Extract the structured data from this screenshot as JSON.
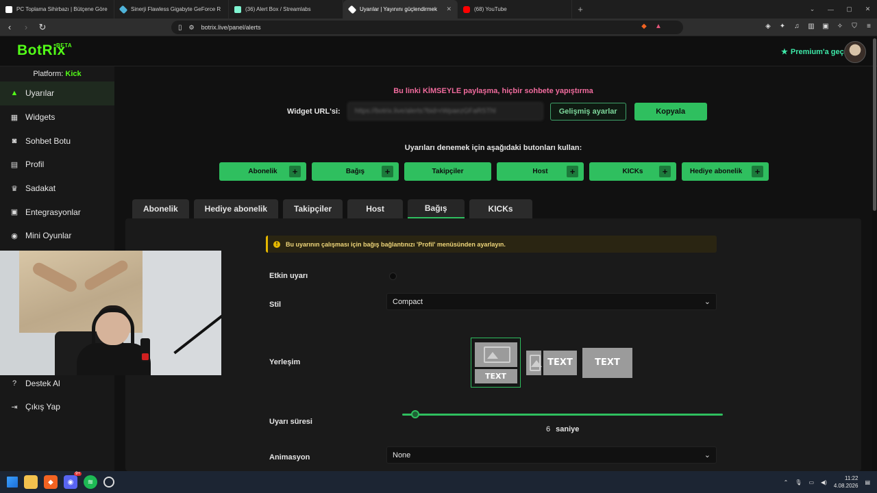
{
  "browser": {
    "tabs": [
      {
        "title": "PC Toplama Sihirbazı | Bütçene Göre",
        "favicon_color": "#ffffff",
        "active": false
      },
      {
        "title": "Sinerji Flawless Gigabyte GeForce R",
        "favicon_color": "#4fb3d9",
        "active": false
      },
      {
        "title": "(36) Alert Box / Streamlabs",
        "favicon_color": "#80f5d2",
        "active": false
      },
      {
        "title": "Uyarılar | Yayınını güçlendirmek",
        "favicon_color": "#ffffff",
        "active": true
      },
      {
        "title": "(68) YouTube",
        "favicon_color": "#ff0000",
        "active": false
      }
    ],
    "url": "botrix.live/panel/alerts"
  },
  "header": {
    "logo": "BotRix",
    "logo_badge": "BETA",
    "premium": "Premium'a geç"
  },
  "sidebar": {
    "platform_label": "Platform:",
    "platform_value": "Kick",
    "items": [
      {
        "label": "Uyarılar",
        "icon": "warning-icon",
        "active": true
      },
      {
        "label": "Widgets",
        "icon": "grid-icon",
        "active": false
      },
      {
        "label": "Sohbet Botu",
        "icon": "robot-icon",
        "active": false
      },
      {
        "label": "Profil",
        "icon": "id-card-icon",
        "active": false
      },
      {
        "label": "Sadakat",
        "icon": "trophy-icon",
        "active": false
      },
      {
        "label": "Entegrasyonlar",
        "icon": "integration-icon",
        "active": false
      },
      {
        "label": "Mini Oyunlar",
        "icon": "gamepad-icon",
        "active": false
      }
    ],
    "bottom_items": [
      {
        "label": "Destek Al",
        "icon": "help-icon"
      },
      {
        "label": "Çıkış Yap",
        "icon": "logout-icon"
      }
    ]
  },
  "main": {
    "share_warning": "Bu linki KİMSEYLE paylaşma, hiçbir sohbete yapıştırma",
    "widget_url_label": "Widget URL'si:",
    "widget_url_value": "https://botrix.live/alerts?bid=rWpaezGFaRSThl",
    "advanced_button": "Gelişmiş ayarlar",
    "copy_button": "Kopyala",
    "test_title": "Uyarıları denemek için aşağıdaki butonları kullan:",
    "test_buttons": [
      "Abonelik",
      "Bağış",
      "Takipçiler",
      "Host",
      "KICKs",
      "Hediye abonelik"
    ],
    "tabs": [
      "Abonelik",
      "Hediye abonelik",
      "Takipçiler",
      "Host",
      "Bağış",
      "KICKs"
    ],
    "active_tab": "Bağış",
    "alert_message": "Bu uyarının çalışması için bağış bağlantınızı 'Profil' menüsünden ayarlayın.",
    "fields": {
      "enabled_label": "Etkin uyarı",
      "style_label": "Stil",
      "style_value": "Compact",
      "layout_label": "Yerleşim",
      "layout_text": "TEXT",
      "duration_label": "Uyarı süresi",
      "duration_value": "6",
      "duration_unit": "saniye",
      "duration_fraction": 0.04,
      "animation_label": "Animasyon",
      "animation_value": "None"
    }
  },
  "taskbar": {
    "time": "11:22",
    "date": "4.08.2026",
    "discord_badge": "9+"
  },
  "colors": {
    "brand": "#53fc18",
    "button_green": "#2fbf5f",
    "warning_pink": "#f06b9d"
  }
}
